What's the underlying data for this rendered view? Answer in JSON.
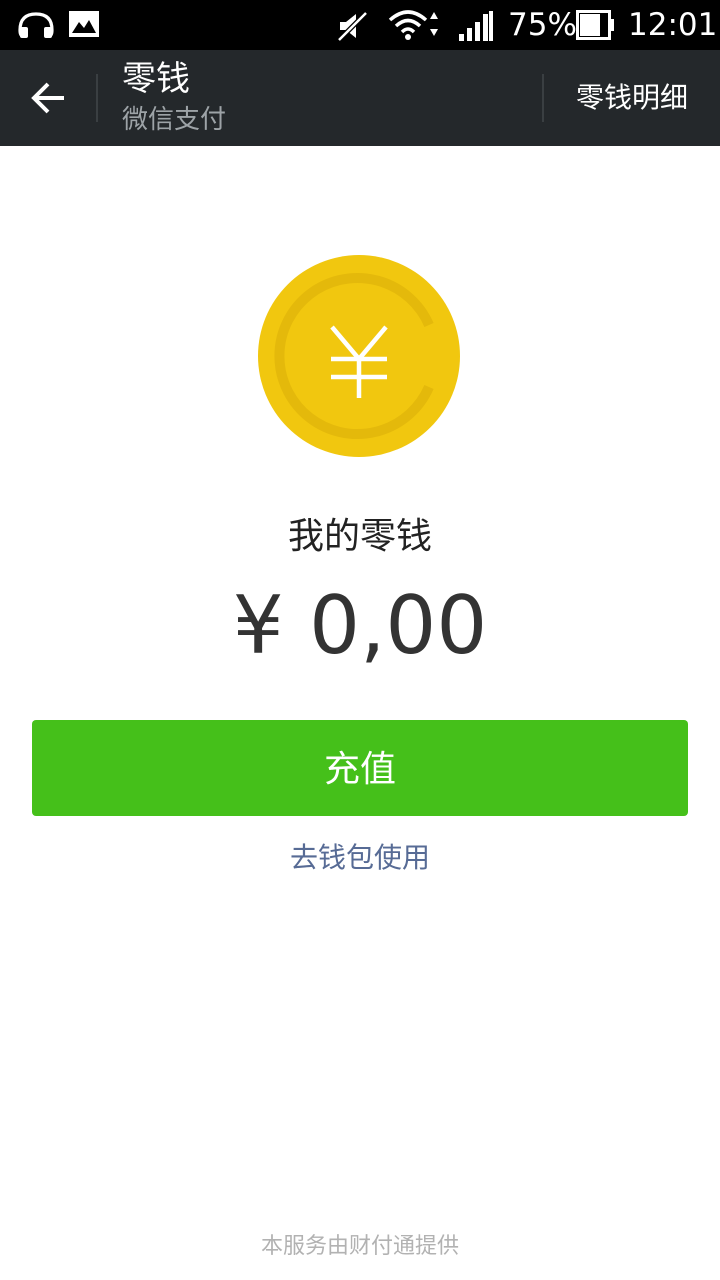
{
  "status_bar": {
    "battery_percent": "75%",
    "time": "12:01",
    "icons": [
      "headset-icon",
      "image-icon",
      "mute-icon",
      "wifi-icon",
      "signal-icon",
      "battery-icon"
    ]
  },
  "header": {
    "title": "零钱",
    "subtitle": "微信支付",
    "action_label": "零钱明细",
    "back_icon": "arrow-left-icon"
  },
  "main": {
    "coin_icon": "yuan-coin-icon",
    "coin_color": "#f1c70f",
    "balance_label": "我的零钱",
    "balance_amount": "¥ 0,00",
    "recharge_label": "充值",
    "recharge_color": "#45c01a",
    "wallet_link": "去钱包使用"
  },
  "footer": {
    "text": "本服务由财付通提供"
  }
}
